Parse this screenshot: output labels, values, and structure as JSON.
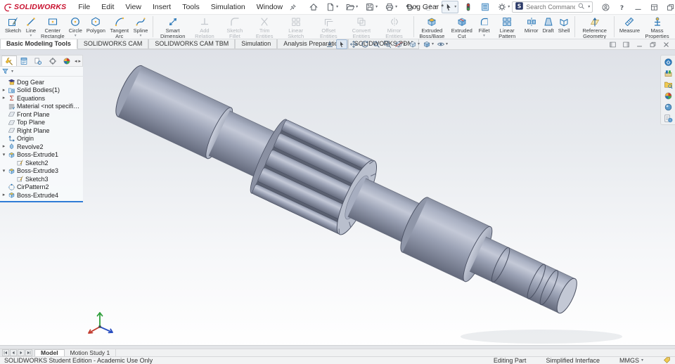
{
  "app": {
    "brand": "SOLIDWORKS",
    "title": "Dog Gear *"
  },
  "menu_bar": {
    "items": [
      "File",
      "Edit",
      "View",
      "Insert",
      "Tools",
      "Simulation",
      "Window"
    ],
    "pin_icon": "pin"
  },
  "quick_toolbar": {
    "items": [
      {
        "name": "home",
        "icon": "home"
      },
      {
        "name": "new-document",
        "icon": "new-doc",
        "flyout": true
      },
      {
        "name": "open",
        "icon": "open-folder",
        "flyout": true
      },
      {
        "name": "save",
        "icon": "save",
        "flyout": true
      },
      {
        "name": "print",
        "icon": "print",
        "flyout": true
      },
      {
        "name": "undo",
        "icon": "undo",
        "flyout": true
      },
      {
        "name": "redo",
        "icon": "redo",
        "flyout": true,
        "disabled": true
      },
      {
        "name": "select",
        "icon": "select-cursor",
        "flyout": true,
        "active": true
      },
      {
        "name": "rebuild",
        "icon": "rebuild-traffic-light"
      },
      {
        "name": "file-properties",
        "icon": "file-properties"
      },
      {
        "name": "options",
        "icon": "options-gear",
        "flyout": true
      }
    ]
  },
  "search": {
    "placeholder": "Search Commands"
  },
  "window_controls": [
    {
      "icon": "user-login"
    },
    {
      "icon": "help"
    },
    {
      "icon": "minimize"
    },
    {
      "icon": "window-layout"
    },
    {
      "icon": "restore"
    },
    {
      "icon": "close"
    }
  ],
  "ribbon": {
    "groups": [
      {
        "buttons": [
          {
            "label": "Sketch",
            "icon": "sketch",
            "enabled": true
          },
          {
            "label": "Line",
            "icon": "line",
            "enabled": true,
            "flyout": true
          },
          {
            "label": "Center Rectangle",
            "icon": "center-rectangle",
            "enabled": true,
            "flyout": true
          },
          {
            "label": "Circle",
            "icon": "circle",
            "enabled": true,
            "flyout": true
          },
          {
            "label": "Polygon",
            "icon": "polygon",
            "enabled": true
          },
          {
            "label": "Tangent Arc",
            "icon": "tangent-arc",
            "enabled": true,
            "flyout": true
          },
          {
            "label": "Spline",
            "icon": "spline",
            "enabled": true,
            "flyout": true
          }
        ]
      },
      {
        "buttons": [
          {
            "label": "Smart Dimension",
            "icon": "smart-dimension",
            "enabled": true,
            "flyout": true
          },
          {
            "label": "Add Relation",
            "icon": "add-relation",
            "enabled": false
          },
          {
            "label": "Sketch Fillet",
            "icon": "sketch-fillet",
            "enabled": false,
            "flyout": true
          },
          {
            "label": "Trim Entities",
            "icon": "trim-entities",
            "enabled": false
          },
          {
            "label": "Linear Sketch Pattern",
            "icon": "linear-sketch-pattern",
            "enabled": false,
            "flyout": true
          },
          {
            "label": "Offset Entities",
            "icon": "offset-entities",
            "enabled": false
          },
          {
            "label": "Convert Entities",
            "icon": "convert-entities",
            "enabled": false
          },
          {
            "label": "Mirror Entities",
            "icon": "mirror-entities",
            "enabled": false
          }
        ]
      },
      {
        "buttons": [
          {
            "label": "Extruded Boss/Base",
            "icon": "extruded-boss",
            "enabled": true
          },
          {
            "label": "Extruded Cut",
            "icon": "extruded-cut",
            "enabled": true,
            "flyout": true
          },
          {
            "label": "Fillet",
            "icon": "fillet",
            "enabled": true,
            "flyout": true
          },
          {
            "label": "Linear Pattern",
            "icon": "linear-pattern",
            "enabled": true,
            "flyout": true
          },
          {
            "label": "Mirror",
            "icon": "mirror-feature",
            "enabled": true
          },
          {
            "label": "Draft",
            "icon": "draft",
            "enabled": true
          },
          {
            "label": "Shell",
            "icon": "shell",
            "enabled": true
          }
        ]
      },
      {
        "buttons": [
          {
            "label": "Reference Geometry",
            "icon": "reference-geometry",
            "enabled": true,
            "flyout": true
          }
        ]
      },
      {
        "buttons": [
          {
            "label": "Measure",
            "icon": "measure",
            "enabled": true
          },
          {
            "label": "Mass Properties",
            "icon": "mass-properties",
            "enabled": true
          }
        ]
      }
    ]
  },
  "command_tabs": {
    "active": "Basic Modeling Tools",
    "items": [
      "Basic Modeling Tools",
      "SOLIDWORKS CAM",
      "SOLIDWORKS CAM TBM",
      "Simulation",
      "Analysis Preparation",
      "SOLIDWORKS PDM"
    ]
  },
  "viewport_toolbar": {
    "items": [
      {
        "name": "zoom-to-fit",
        "icon": "zoom-to-fit"
      },
      {
        "name": "select",
        "icon": "select-cursor",
        "active": true
      },
      {
        "name": "pan",
        "icon": "pan"
      },
      {
        "name": "rotate-view",
        "icon": "rotate-view"
      },
      {
        "name": "zoom-in-out",
        "icon": "magnifier"
      },
      {
        "name": "zoom-to-area",
        "icon": "zoom-to-area"
      },
      {
        "name": "section-view",
        "icon": "section-view",
        "flyout": true
      },
      {
        "name": "view-orientation",
        "icon": "view-orientation",
        "flyout": true
      },
      {
        "name": "display-style",
        "icon": "display-style",
        "flyout": true
      },
      {
        "name": "hide-show-items",
        "icon": "hide-show-items",
        "flyout": true
      }
    ]
  },
  "doc_window_controls": [
    {
      "icon": "pane-left"
    },
    {
      "icon": "pane-right"
    },
    {
      "icon": "minimize"
    },
    {
      "icon": "restore"
    },
    {
      "icon": "close"
    }
  ],
  "feature_panel": {
    "tabs": [
      {
        "icon": "featuremanager-tree",
        "active": true
      },
      {
        "icon": "propertymanager"
      },
      {
        "icon": "configurationmanager"
      },
      {
        "icon": "dimxpertmanager"
      },
      {
        "icon": "displaymanager"
      }
    ],
    "filter_icon": "filter-funnel",
    "tree": [
      {
        "label": "Dog Gear",
        "icon": "part-student",
        "level": 0,
        "expander": null
      },
      {
        "label": "Solid Bodies(1)",
        "icon": "solid-bodies-folder",
        "level": 0,
        "expander": "collapsed"
      },
      {
        "label": "Equations",
        "icon": "equations",
        "level": 0,
        "expander": "collapsed"
      },
      {
        "label": "Material <not specified>",
        "icon": "material",
        "level": 0,
        "expander": null
      },
      {
        "label": "Front Plane",
        "icon": "plane",
        "level": 0,
        "expander": null
      },
      {
        "label": "Top Plane",
        "icon": "plane",
        "level": 0,
        "expander": null
      },
      {
        "label": "Right Plane",
        "icon": "plane",
        "level": 0,
        "expander": null
      },
      {
        "label": "Origin",
        "icon": "origin",
        "level": 0,
        "expander": null
      },
      {
        "label": "Revolve2",
        "icon": "revolve",
        "level": 0,
        "expander": "collapsed"
      },
      {
        "label": "Boss-Extrude1",
        "icon": "boss-extrude",
        "level": 0,
        "expander": "expanded"
      },
      {
        "label": "Sketch2",
        "icon": "sketch-feature",
        "level": 1,
        "expander": null
      },
      {
        "label": "Boss-Extrude3",
        "icon": "boss-extrude",
        "level": 0,
        "expander": "expanded"
      },
      {
        "label": "Sketch3",
        "icon": "sketch-feature",
        "level": 1,
        "expander": null
      },
      {
        "label": "CirPattern2",
        "icon": "circular-pattern",
        "level": 0,
        "expander": null
      },
      {
        "label": "Boss-Extrude4",
        "icon": "boss-extrude",
        "level": 0,
        "expander": "collapsed"
      }
    ],
    "rollback_color": "#2f7cd6"
  },
  "task_pane": {
    "items": [
      {
        "icon": "solidworks-resources"
      },
      {
        "icon": "design-library"
      },
      {
        "icon": "file-explorer"
      },
      {
        "icon": "view-palette"
      },
      {
        "icon": "appearances-scenes"
      },
      {
        "icon": "custom-properties"
      }
    ]
  },
  "bottom_tabs": {
    "nav_icons": [
      "first",
      "prev",
      "next",
      "last"
    ],
    "items": [
      {
        "label": "Model",
        "active": true
      },
      {
        "label": "Motion Study 1",
        "active": false
      }
    ]
  },
  "status_bar": {
    "left": "SOLIDWORKS Student Edition - Academic Use Only",
    "mode": "Editing Part",
    "interface_label": "Simplified Interface",
    "units": "MMGS",
    "tag_icon": "tag"
  },
  "viewport": {
    "model": "Dog Gear",
    "triad": {
      "x_color": "#c23b2e",
      "y_color": "#2e9e3a",
      "z_color": "#2a4fc0"
    },
    "colors": {
      "bg_top": "#dfe2e8",
      "bg_bottom": "#ffffff",
      "metal_light": "#c4c9d7",
      "metal_mid": "#9ba2b5",
      "metal_dark": "#656b7d",
      "edge": "#4a5062",
      "accent_blue": "#2373b5",
      "brand_red": "#c8102e"
    }
  }
}
